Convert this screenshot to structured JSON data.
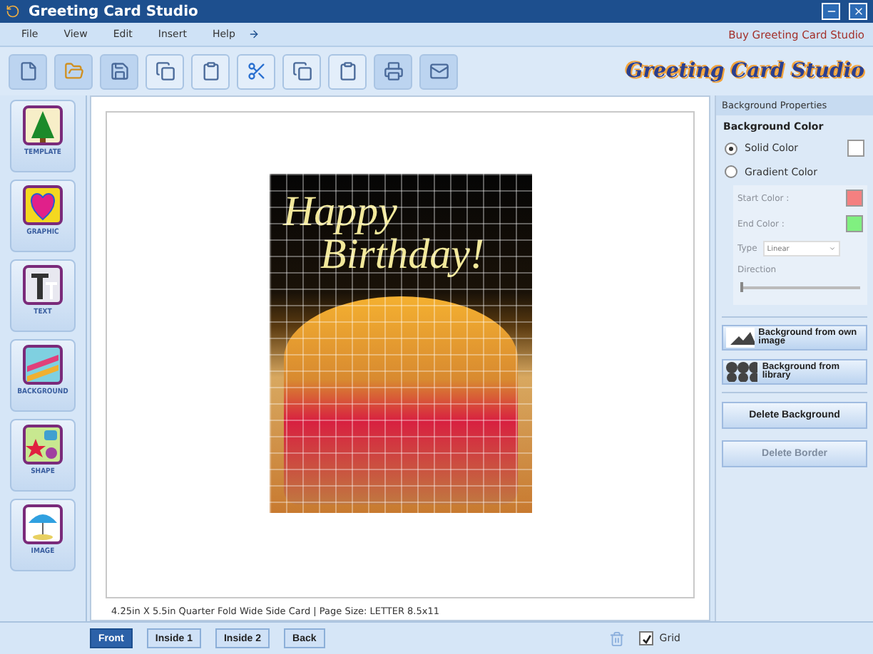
{
  "window": {
    "title": "Greeting Card Studio"
  },
  "menu": [
    "File",
    "View",
    "Edit",
    "Insert",
    "Help"
  ],
  "buy_link": "Buy Greeting Card Studio",
  "logo": {
    "text": "Greeting Card Studio"
  },
  "tools": [
    {
      "kind": "template",
      "label": "TEMPLATE"
    },
    {
      "kind": "graphic",
      "label": "GRAPHIC"
    },
    {
      "kind": "text",
      "label": "TEXT"
    },
    {
      "kind": "background",
      "label": "BACKGROUND"
    },
    {
      "kind": "shape",
      "label": "SHAPE"
    },
    {
      "kind": "image",
      "label": "IMAGE"
    }
  ],
  "card": {
    "lines": [
      "Happy",
      "Birthday!"
    ],
    "grid": true
  },
  "canvas_status": "4.25in X 5.5in Quarter Fold Wide Side Card | Page Size: LETTER 8.5x11",
  "panel": {
    "title": "Background Properties",
    "section": "Background Color",
    "options": [
      {
        "label": "Solid Color",
        "selected": true
      },
      {
        "label": "Gradient Color",
        "selected": false
      }
    ],
    "gradient": {
      "disabled": true,
      "colors": [
        {
          "label": "Start Color :",
          "color": "#f48080"
        },
        {
          "label": "End Color :",
          "color": "#80f080"
        }
      ],
      "type_label": "Type",
      "type_value": "Linear",
      "direction_label": "Direction",
      "direction": {
        "level": 0
      }
    },
    "image_buttons": [
      {
        "kind": "own",
        "label": "Background from own image"
      },
      {
        "kind": "library",
        "label": "Background from library"
      }
    ],
    "actions": [
      {
        "label": "Delete Background",
        "disabled": false
      },
      {
        "label": "Delete Border",
        "disabled": true
      }
    ]
  },
  "pages": [
    {
      "label": "Front",
      "selected": true
    },
    {
      "label": "Inside 1",
      "selected": false
    },
    {
      "label": "Inside 2",
      "selected": false
    },
    {
      "label": "Back",
      "selected": false
    }
  ],
  "grid_toggle": {
    "label": "Grid",
    "checked": true
  }
}
